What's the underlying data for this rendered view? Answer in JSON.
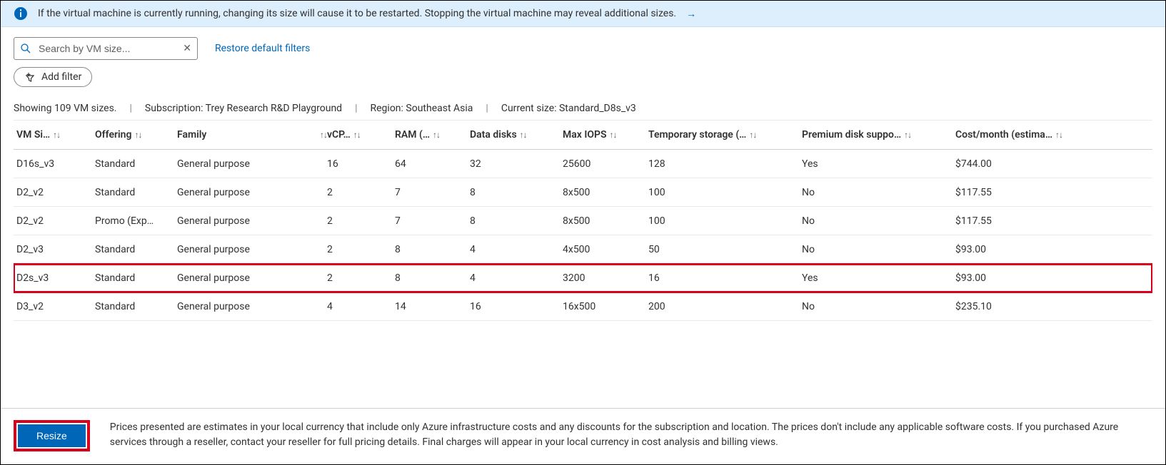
{
  "banner": {
    "text": "If the virtual machine is currently running, changing its size will cause it to be restarted. Stopping the virtual machine may reveal additional sizes."
  },
  "search": {
    "placeholder": "Search by VM size..."
  },
  "links": {
    "restore_filters": "Restore default filters"
  },
  "add_filter_label": "Add filter",
  "status": {
    "count_text": "Showing 109 VM sizes.",
    "subscription_text": "Subscription: Trey Research R&D Playground",
    "region_text": "Region: Southeast Asia",
    "current_size_text": "Current size: Standard_D8s_v3"
  },
  "columns": {
    "vm_size": "VM Si…",
    "offering": "Offering",
    "family": "Family",
    "vcpus": "vCP…",
    "ram": "RAM (…",
    "data_disks": "Data disks",
    "max_iops": "Max IOPS",
    "temp_storage": "Temporary storage (…",
    "premium_disk": "Premium disk suppo…",
    "cost": "Cost/month (estima…"
  },
  "rows": [
    {
      "vm_size": "D16s_v3",
      "offering": "Standard",
      "family": "General purpose",
      "vcpus": "16",
      "ram": "64",
      "data_disks": "32",
      "max_iops": "25600",
      "temp_storage": "128",
      "premium_disk": "Yes",
      "cost": "$744.00",
      "highlight": false
    },
    {
      "vm_size": "D2_v2",
      "offering": "Standard",
      "family": "General purpose",
      "vcpus": "2",
      "ram": "7",
      "data_disks": "8",
      "max_iops": "8x500",
      "temp_storage": "100",
      "premium_disk": "No",
      "cost": "$117.55",
      "highlight": false
    },
    {
      "vm_size": "D2_v2",
      "offering": "Promo (Exp…",
      "family": "General purpose",
      "vcpus": "2",
      "ram": "7",
      "data_disks": "8",
      "max_iops": "8x500",
      "temp_storage": "100",
      "premium_disk": "No",
      "cost": "$117.55",
      "highlight": false
    },
    {
      "vm_size": "D2_v3",
      "offering": "Standard",
      "family": "General purpose",
      "vcpus": "2",
      "ram": "8",
      "data_disks": "4",
      "max_iops": "4x500",
      "temp_storage": "50",
      "premium_disk": "No",
      "cost": "$93.00",
      "highlight": false
    },
    {
      "vm_size": "D2s_v3",
      "offering": "Standard",
      "family": "General purpose",
      "vcpus": "2",
      "ram": "8",
      "data_disks": "4",
      "max_iops": "3200",
      "temp_storage": "16",
      "premium_disk": "Yes",
      "cost": "$93.00",
      "highlight": true
    },
    {
      "vm_size": "D3_v2",
      "offering": "Standard",
      "family": "General purpose",
      "vcpus": "4",
      "ram": "14",
      "data_disks": "16",
      "max_iops": "16x500",
      "temp_storage": "200",
      "premium_disk": "No",
      "cost": "$235.10",
      "highlight": false
    }
  ],
  "footer": {
    "button_label": "Resize",
    "text": "Prices presented are estimates in your local currency that include only Azure infrastructure costs and any discounts for the subscription and location. The prices don't include any applicable software costs. If you purchased Azure services through a reseller, contact your reseller for full pricing details. Final charges will appear in your local currency in cost analysis and billing views."
  }
}
